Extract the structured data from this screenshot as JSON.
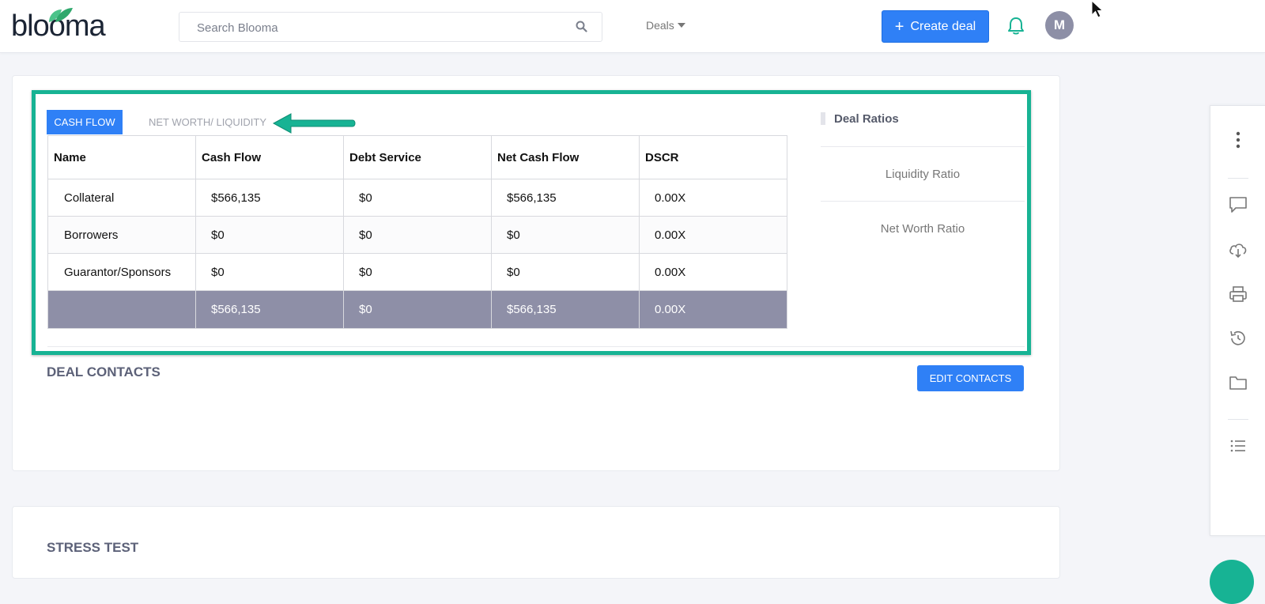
{
  "header": {
    "logo_text": "blooma",
    "search_placeholder": "Search Blooma",
    "deals_label": "Deals",
    "create_deal_label": "Create deal",
    "avatar_initial": "M"
  },
  "tabs": [
    {
      "label": "CASH FLOW",
      "active": true
    },
    {
      "label": "NET WORTH/ LIQUIDITY",
      "active": false
    }
  ],
  "table": {
    "columns": [
      "Name",
      "Cash Flow",
      "Debt Service",
      "Net Cash Flow",
      "DSCR"
    ],
    "rows": [
      [
        "Collateral",
        "$566,135",
        "$0",
        "$566,135",
        "0.00X"
      ],
      [
        "Borrowers",
        "$0",
        "$0",
        "$0",
        "0.00X"
      ],
      [
        "Guarantor/Sponsors",
        "$0",
        "$0",
        "$0",
        "0.00X"
      ]
    ],
    "total": [
      "",
      "$566,135",
      "$0",
      "$566,135",
      "0.00X"
    ]
  },
  "deal_ratios": {
    "title": "Deal Ratios",
    "items": [
      "Liquidity Ratio",
      "Net Worth Ratio"
    ]
  },
  "deal_contacts": {
    "title": "DEAL CONTACTS",
    "edit_label": "EDIT CONTACTS"
  },
  "stress_test": {
    "title": "STRESS TEST"
  },
  "colors": {
    "accent": "#2f80f6",
    "highlight": "#17b394",
    "total_row": "#8e8fa7"
  }
}
